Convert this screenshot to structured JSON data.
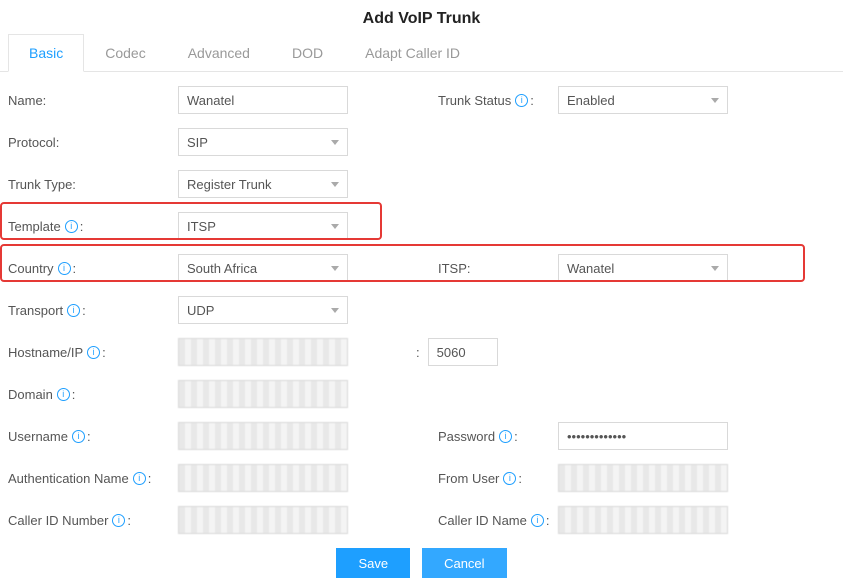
{
  "title": "Add VoIP Trunk",
  "tabs": {
    "basic": "Basic",
    "codec": "Codec",
    "advanced": "Advanced",
    "dod": "DOD",
    "adapt": "Adapt Caller ID"
  },
  "labels": {
    "name": "Name:",
    "trunk_status": "Trunk Status",
    "protocol": "Protocol:",
    "trunk_type": "Trunk Type:",
    "template": "Template",
    "country": "Country",
    "itsp": "ITSP:",
    "transport": "Transport",
    "hostname": "Hostname/IP",
    "domain": "Domain",
    "username": "Username",
    "password": "Password",
    "auth_name": "Authentication Name",
    "from_user": "From User",
    "caller_id_num": "Caller ID Number",
    "caller_id_name": "Caller ID Name",
    "colon": ":"
  },
  "values": {
    "name": "Wanatel",
    "trunk_status": "Enabled",
    "protocol": "SIP",
    "trunk_type": "Register Trunk",
    "template": "ITSP",
    "country": "South Africa",
    "itsp": "Wanatel",
    "transport": "UDP",
    "port": "5060",
    "password": "•••••••••••••"
  },
  "buttons": {
    "save": "Save",
    "cancel": "Cancel"
  },
  "icon": {
    "info": "i"
  }
}
